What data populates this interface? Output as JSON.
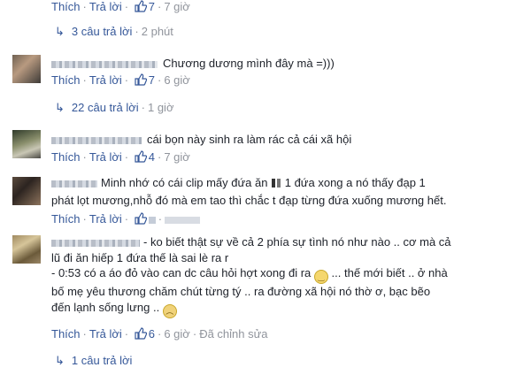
{
  "actions": {
    "like": "Thích",
    "reply": "Trả lời",
    "edited": "Đã chỉnh sửa"
  },
  "rows": [
    {
      "likes": "7",
      "time": "7 giờ"
    }
  ],
  "replies": [
    {
      "text": "3 câu trả lời",
      "time": "2 phút"
    },
    {
      "text": "22 câu trả lời",
      "time": "1 giờ"
    },
    {
      "text": "1 câu trả lời"
    }
  ],
  "comments": [
    {
      "text": "Chương dương mình đây mà =)))",
      "likes": "7",
      "time": "6 giờ"
    },
    {
      "text": "cái bọn này sinh ra làm rác cả cái xã hội",
      "likes": "4",
      "time": "7 giờ"
    },
    {
      "line1a": "Minh nhớ có cái clip mấy đứa ăn",
      "line1b": "1 đứa xong a nó thấy đạp 1",
      "line2": "phát lọt mương,nhỗ đó mà em tao thì chắc t đạp từng đứa xuống mương hết.",
      "likes": "",
      "time": ""
    },
    {
      "line1": "- ko biết thật sự về cả 2 phía sự tình nó như nào .. cơ mà cả",
      "line2": "lũ đi ăn hiếp 1 đứa thế là sai lè ra r",
      "line3a": "- 0:53 có a áo đỏ vào can dc câu hỏi hợt xong đi ra",
      "line3b": "... thế mới biết .. ở nhà",
      "line4": "bố mẹ yêu thương chăm chút từng tý .. ra đường xã hội nó thờ ơ, bạc bẽo",
      "line5": "đến lạnh sống lưng ..",
      "likes": "6",
      "time": "6 giờ"
    }
  ],
  "colors": {
    "link": "#365899",
    "muted": "#90949c",
    "text": "#1d2129"
  }
}
